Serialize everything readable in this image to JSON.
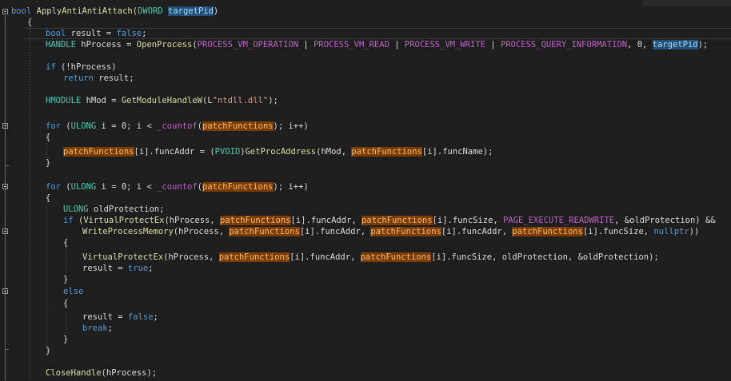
{
  "editor": {
    "language": "cpp",
    "colors": {
      "background": "#1e1e1e",
      "keyword": "#569cd6",
      "type": "#4ec9b0",
      "function": "#dcdcaa",
      "string": "#d69d85",
      "macro": "#bd63c5",
      "highlight_orange": "#7a3d00",
      "highlight_blue": "#264f78"
    },
    "highlighted_symbols": [
      "patchFunctions",
      "targetPid"
    ]
  },
  "code": {
    "l1_kw": "bool",
    "l1_name": " ApplyAntiAntiAttach(",
    "l1_type": "DWORD",
    "l1_sp": " ",
    "l1_param": "targetPid",
    "l1_end": ")",
    "l2": "{",
    "l3_kw": "bool",
    "l3_rest": " result = ",
    "l3_false": "false",
    "l3_end": ";",
    "l4_type": "HANDLE",
    "l4_a": " hProcess = ",
    "l4_fn": "OpenProcess",
    "l4_b": "(",
    "l4_m1": "PROCESS_VM_OPERATION",
    "l4_sep1": " | ",
    "l4_m2": "PROCESS_VM_READ",
    "l4_sep2": " | ",
    "l4_m3": "PROCESS_VM_WRITE",
    "l4_sep3": " | ",
    "l4_m4": "PROCESS_QUERY_INFORMATION",
    "l4_c": ", 0, ",
    "l4_param": "targetPid",
    "l4_end": ");",
    "l5_kw": "if",
    "l5_rest": " (!hProcess)",
    "l6_kw": "return",
    "l6_rest": " result;",
    "l7_type": "HMODULE",
    "l7_a": " hMod = ",
    "l7_fn": "GetModuleHandleW",
    "l7_b": "(L",
    "l7_str": "\"ntdll.dll\"",
    "l7_end": ");",
    "l8_kw": "for",
    "l8_a": " (",
    "l8_type": "ULONG",
    "l8_b": " i = 0; i < ",
    "l8_mac": "_countof",
    "l8_c": "(",
    "l8_hl": "patchFunctions",
    "l8_end": "); i++)",
    "l9": "{",
    "l10_hl": "patchFunctions",
    "l10_a": "[i].funcAddr = (",
    "l10_type": "PVOID",
    "l10_b": ")",
    "l10_fn": "GetProcAddress",
    "l10_c": "(hMod, ",
    "l10_hl2": "patchFunctions",
    "l10_end": "[i].funcName);",
    "l11": "}",
    "l12_kw": "for",
    "l12_a": " (",
    "l12_type": "ULONG",
    "l12_b": " i = 0; i < ",
    "l12_mac": "_countof",
    "l12_c": "(",
    "l12_hl": "patchFunctions",
    "l12_end": "); i++)",
    "l13": "{",
    "l14_type": "ULONG",
    "l14_rest": " oldProtection;",
    "l15_kw": "if",
    "l15_a": " (",
    "l15_fn": "VirtualProtectEx",
    "l15_b": "(hProcess, ",
    "l15_hl1": "patchFunctions",
    "l15_c": "[i].funcAddr, ",
    "l15_hl2": "patchFunctions",
    "l15_d": "[i].funcSize, ",
    "l15_mac": "PAGE_EXECUTE_READWRITE",
    "l15_end": ", &oldProtection) &&",
    "l16_fn": "WriteProcessMemory",
    "l16_a": "(hProcess, ",
    "l16_hl1": "patchFunctions",
    "l16_b": "[i].funcAddr, ",
    "l16_hl2": "patchFunctions",
    "l16_c": "[i].funcAddr, ",
    "l16_hl3": "patchFunctions",
    "l16_d": "[i].funcSize, ",
    "l16_kw": "nullptr",
    "l16_end": "))",
    "l17": "{",
    "l18_fn": "VirtualProtectEx",
    "l18_a": "(hProcess, ",
    "l18_hl1": "patchFunctions",
    "l18_b": "[i].funcAddr, ",
    "l18_hl2": "patchFunctions",
    "l18_end": "[i].funcSize, oldProtection, &oldProtection);",
    "l19_a": "result = ",
    "l19_kw": "true",
    "l19_end": ";",
    "l20": "}",
    "l21_kw": "else",
    "l22": "{",
    "l23_a": "result = ",
    "l23_kw": "false",
    "l23_end": ";",
    "l24_kw": "break",
    "l24_end": ";",
    "l25": "}",
    "l26": "}",
    "l27_fn": "CloseHandle",
    "l27_end": "(hProcess);"
  }
}
